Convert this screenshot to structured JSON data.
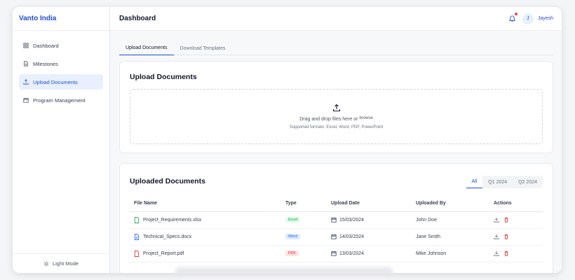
{
  "brand": "Vanto India",
  "sidebar": {
    "items": [
      {
        "label": "Dashboard",
        "icon": "grid-icon",
        "active": false
      },
      {
        "label": "Milestones",
        "icon": "file-icon",
        "active": false
      },
      {
        "label": "Upload Documents",
        "icon": "upload-icon",
        "active": true
      },
      {
        "label": "Program Management",
        "icon": "calendar-icon",
        "active": false
      }
    ],
    "light_mode_label": "Light Mode"
  },
  "header": {
    "title": "Dashboard",
    "avatar_initial": "J",
    "username": "Jayesh"
  },
  "tabs": [
    "Upload Documents",
    "Download Templates"
  ],
  "upload_card": {
    "title": "Upload Documents",
    "drop_text": "Drag and drop files here or",
    "browse_label": "browse",
    "formats_text": "Supported formats: Excel, Word, PDF, PowerPoint"
  },
  "docs_card": {
    "title": "Uploaded Documents",
    "filters": [
      "All",
      "Q1 2024",
      "Q2 2024"
    ],
    "columns": [
      "File Name",
      "Type",
      "Upload Date",
      "Uploaded By",
      "Actions"
    ],
    "rows": [
      {
        "file": "Project_Requirements.xlsx",
        "type": "Excel",
        "date": "15/03/2024",
        "by": "John Doe"
      },
      {
        "file": "Technical_Specs.docx",
        "type": "Word",
        "date": "14/03/2024",
        "by": "Jane Smith"
      },
      {
        "file": "Project_Report.pdf",
        "type": "PDF",
        "date": "13/03/2024",
        "by": "Mike Johnson"
      }
    ]
  },
  "colors": {
    "accent": "#1d4ed8",
    "excel": "#16a34a",
    "word": "#2563eb",
    "pdf": "#dc2626"
  }
}
